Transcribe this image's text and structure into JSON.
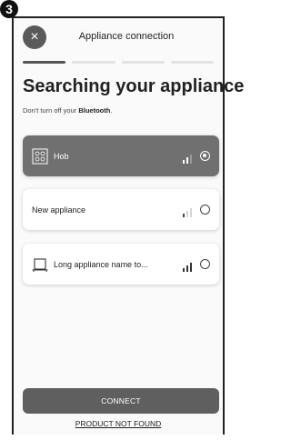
{
  "step_badge": "3",
  "header": {
    "close_glyph": "×",
    "title": "Appliance connection"
  },
  "progress": {
    "total_steps": 4,
    "current_step": 1
  },
  "main": {
    "title": "Searching your appliance",
    "subtitle_prefix": "Don't turn off your ",
    "subtitle_bold": "Bluetooth",
    "subtitle_suffix": "."
  },
  "appliances": [
    {
      "label": "Hob",
      "icon": "hob-icon",
      "selected": true,
      "signal_bars": 2
    },
    {
      "label": "New appliance",
      "icon": "",
      "selected": false,
      "signal_bars": 1
    },
    {
      "label": "Long appliance name to...",
      "icon": "oven-icon",
      "selected": false,
      "signal_bars": 3
    }
  ],
  "actions": {
    "connect_label": "CONNECT",
    "not_found_label": "PRODUCT NOT FOUND"
  },
  "colors": {
    "selected_card": "#707070",
    "button": "#5f5f5f",
    "progress_active": "#555555"
  }
}
